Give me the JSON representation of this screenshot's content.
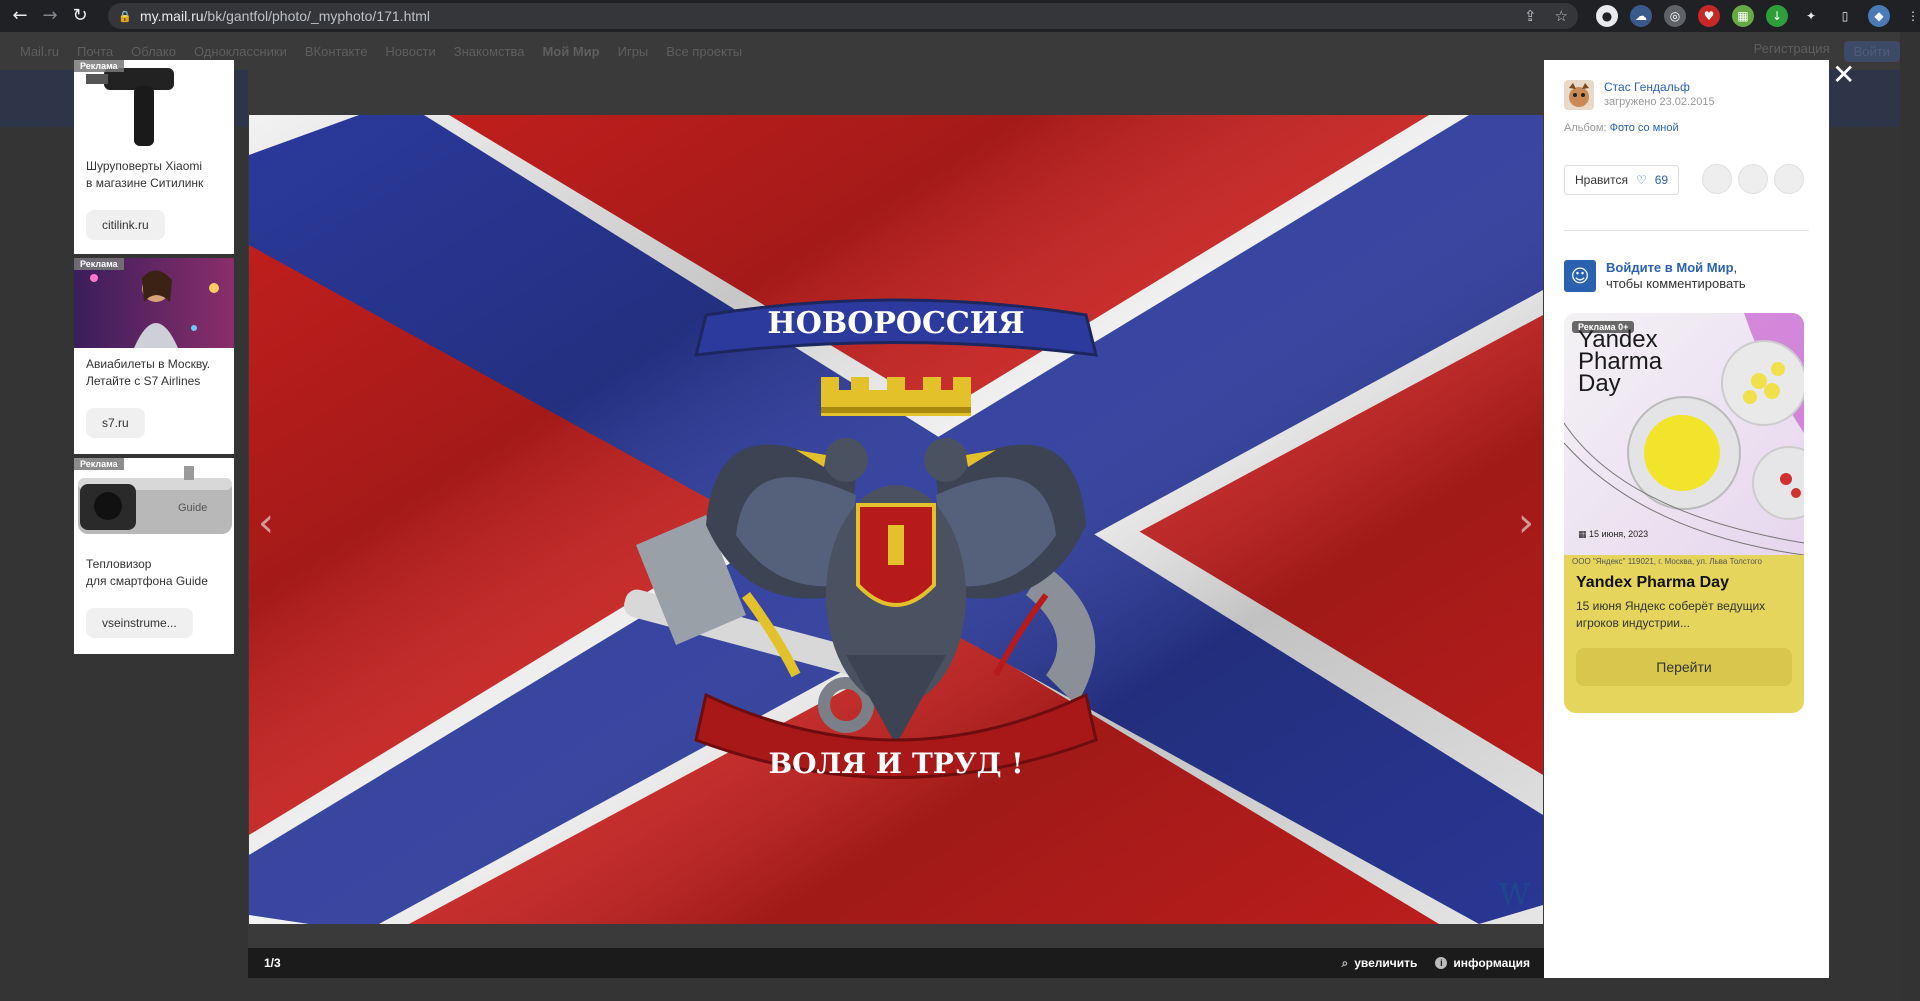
{
  "browser": {
    "url_host": "my.mail.ru",
    "url_path": "/bk/gantfol/photo/_myphoto/171.html"
  },
  "site_nav": {
    "items": [
      "Mail.ru",
      "Почта",
      "Облако",
      "Одноклассники",
      "ВКонтакте",
      "Новости",
      "Знакомства",
      "Мой Мир",
      "Игры",
      "Все проекты"
    ],
    "register": "Регистрация",
    "enter": "Войти"
  },
  "ads": [
    {
      "tag": "Реклама",
      "title_line1": "Шуруповерты Xiaomi",
      "title_line2": "в магазине Ситилинк",
      "link": "citilink.ru"
    },
    {
      "tag": "Реклама",
      "title_line1": "Авиабилеты в Москву.",
      "title_line2": "Летайте с S7 Airlines",
      "link": "s7.ru"
    },
    {
      "tag": "Реклама",
      "title_line1": "Тепловизор",
      "title_line2": "для смартфона Guide",
      "link": "vseinstrume..."
    }
  ],
  "ad_product_text": {
    "guide_logo": "Guide"
  },
  "photo": {
    "banner_top": "НОВОРОССИЯ",
    "banner_bottom": "ВОЛЯ И ТРУД !"
  },
  "viewer": {
    "counter": "1/3",
    "zoom_label": "увеличить",
    "info_label": "информация"
  },
  "panel": {
    "author": "Стас Гендальф",
    "uploaded": "загружено 23.02.2015",
    "album_label": "Альбом:",
    "album_name": "Фото со мной",
    "like_label": "Нравится",
    "like_count": "69",
    "login_link": "Войдите в Мой Мир",
    "login_rest": "чтобы комментировать"
  },
  "yandex_ad": {
    "tag": "Реклама 0+",
    "headline": "Yandex Pharma Day",
    "date": "15 июня, 2023",
    "legal": "ООО \"Яндекс\" 119021, г. Москва, ул. Льва Толстого",
    "title": "Yandex Pharma Day",
    "desc": "15 июня Яндекс соберёт ведущих игроков индустрии...",
    "button": "Перейти"
  },
  "colors": {
    "flag_red": "#c8201e",
    "flag_blue": "#2b3a9c",
    "link_blue": "#2a62b0",
    "ad_yellow": "#e6d55c"
  }
}
